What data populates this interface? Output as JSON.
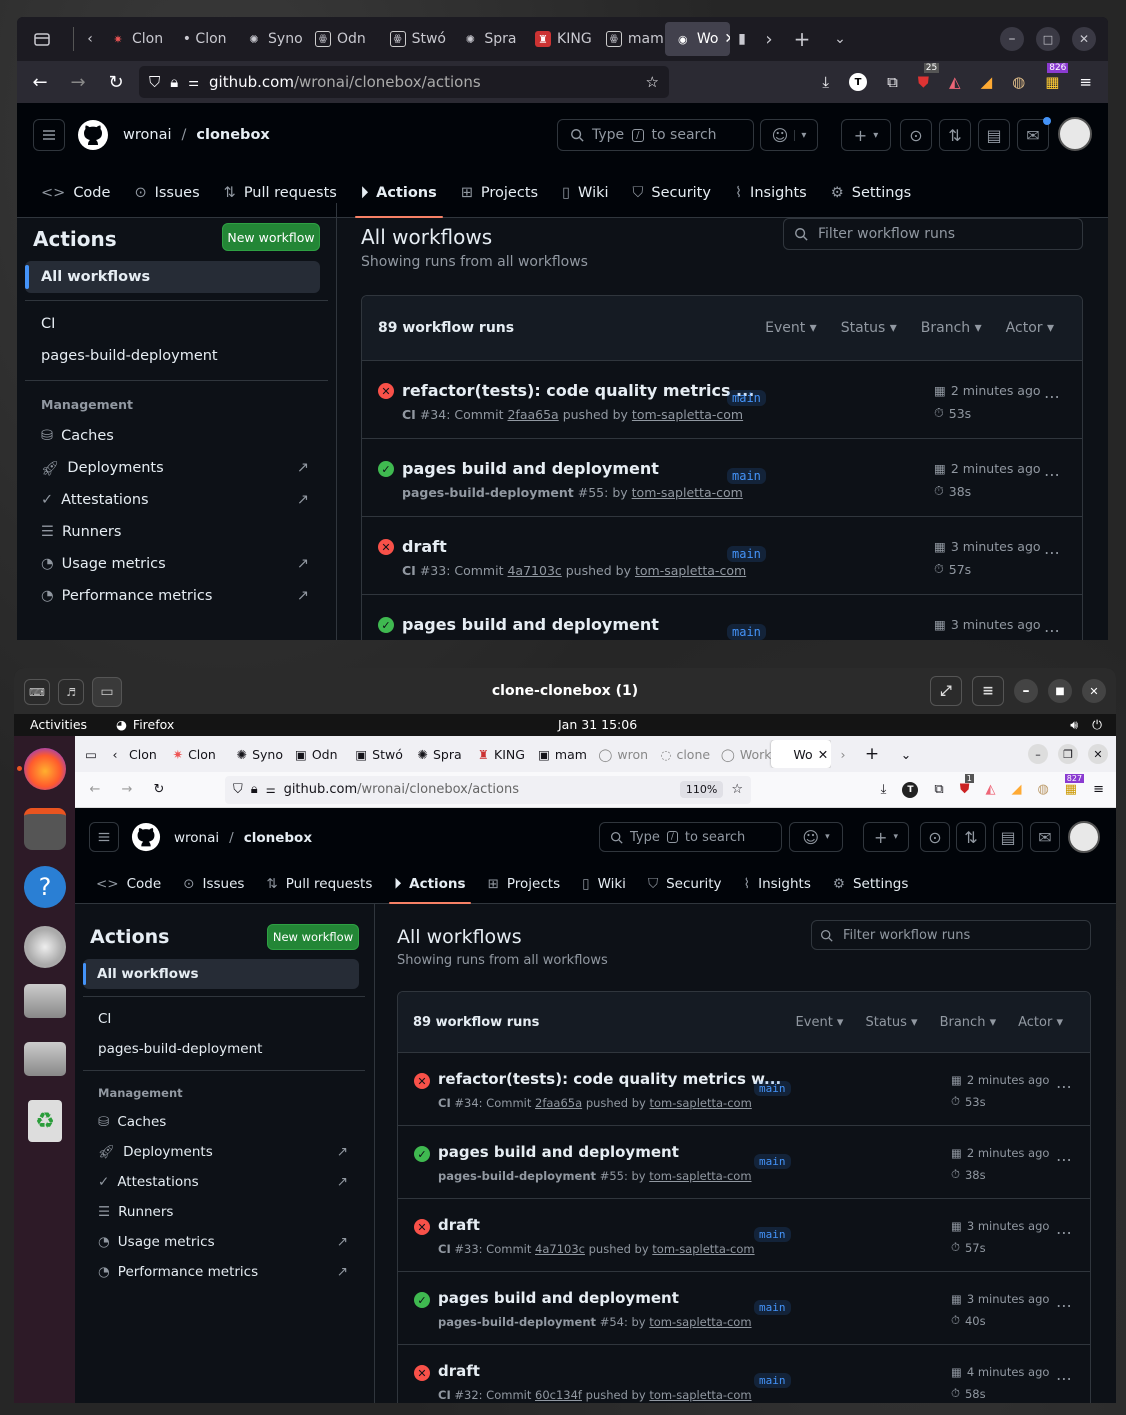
{
  "top": {
    "tabs": [
      "Clon",
      "• Clon",
      "Syno",
      "Odn",
      "Stwó",
      "Spra",
      "KING",
      "mam",
      "Wo"
    ],
    "url_prefix": "github.com",
    "url_path": "/wronai/clonebox/actions",
    "ext_badges": {
      "b1": "25",
      "b2": "826"
    }
  },
  "bottom": {
    "window_title": "clone-clonebox (1)",
    "gnome": {
      "activities": "Activities",
      "app": "Firefox",
      "clock": "Jan 31  15:06"
    },
    "tabs": [
      "Clon",
      "Clon",
      "Syno",
      "Odn",
      "Stwó",
      "Spra",
      "KING",
      "mam",
      "wron",
      "clone",
      "Work",
      "Wo"
    ],
    "url_prefix": "github.com",
    "url_path": "/wronai/clonebox/actions",
    "zoom": "110%",
    "ext_badges": {
      "b1": "1",
      "b2": "827"
    }
  },
  "github": {
    "owner": "wronai",
    "sep": "/",
    "repo": "clonebox",
    "search_pre": "Type",
    "search_key": "/",
    "search_post": "to search",
    "nav": [
      "Code",
      "Issues",
      "Pull requests",
      "Actions",
      "Projects",
      "Wiki",
      "Security",
      "Insights",
      "Settings"
    ],
    "sidebar": {
      "title": "Actions",
      "new_workflow": "New workflow",
      "all": "All workflows",
      "workflows": [
        "CI",
        "pages-build-deployment"
      ],
      "management_label": "Management",
      "management": [
        "Caches",
        "Deployments",
        "Attestations",
        "Runners",
        "Usage metrics",
        "Performance metrics"
      ]
    },
    "main": {
      "title": "All workflows",
      "subtitle": "Showing runs from all workflows",
      "filter_placeholder": "Filter workflow runs",
      "count": "89 workflow runs",
      "filters": [
        "Event",
        "Status",
        "Branch",
        "Actor"
      ]
    },
    "runs": [
      {
        "status": "failure",
        "title_top": "refactor(tests): code quality metrics ...",
        "title_bottom": "refactor(tests): code quality metrics w...",
        "wf": "CI",
        "meta_a": "#34: Commit",
        "commit": "2faa65a",
        "meta_b": "pushed by",
        "user": "tom-sapletta-com",
        "branch": "main",
        "when": "2 minutes ago",
        "dur": "53s"
      },
      {
        "status": "success",
        "title_top": "pages build and deployment",
        "title_bottom": "pages build and deployment",
        "wf": "pages-build-deployment",
        "meta_a": "#55: by",
        "commit": "",
        "meta_b": "",
        "user": "tom-sapletta-com",
        "branch": "main",
        "when": "2 minutes ago",
        "dur": "38s"
      },
      {
        "status": "failure",
        "title_top": "draft",
        "title_bottom": "draft",
        "wf": "CI",
        "meta_a": "#33: Commit",
        "commit": "4a7103c",
        "meta_b": "pushed by",
        "user": "tom-sapletta-com",
        "branch": "main",
        "when": "3 minutes ago",
        "dur": "57s"
      },
      {
        "status": "success",
        "title_top": "pages build and deployment",
        "title_bottom": "pages build and deployment",
        "wf": "pages-build-deployment",
        "meta_a": "#54: by",
        "commit": "",
        "meta_b": "",
        "user": "tom-sapletta-com",
        "branch": "main",
        "when": "3 minutes ago",
        "dur": "40s"
      },
      {
        "status": "failure",
        "title_top": "",
        "title_bottom": "draft",
        "wf": "CI",
        "meta_a": "#32: Commit",
        "commit": "60c134f",
        "meta_b": "pushed by",
        "user": "tom-sapletta-com",
        "branch": "main",
        "when": "4 minutes ago",
        "dur": "58s"
      }
    ]
  },
  "colors": {
    "accent_underline": "#f78166",
    "success": "#3fb950",
    "failure": "#f85149",
    "new_button": "#238636"
  }
}
